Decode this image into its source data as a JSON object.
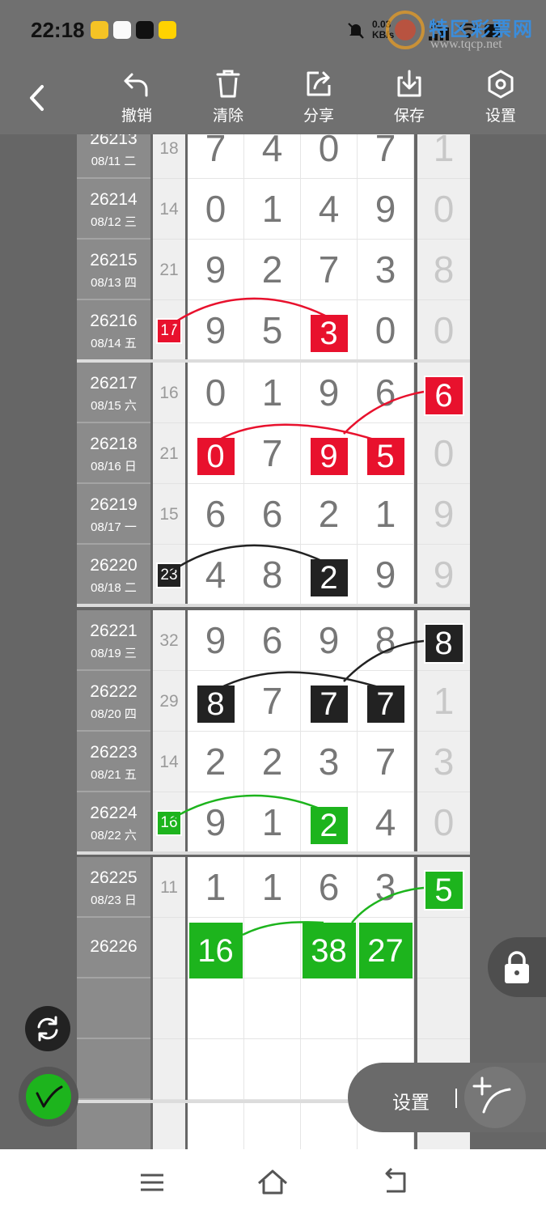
{
  "status_bar": {
    "time": "22:18",
    "net_speed_top": "0.03",
    "net_speed_unit": "KB/s",
    "signal_label": "5G",
    "watermark_title": "特区彩票网",
    "watermark_url": "www.tqcp.net"
  },
  "toolbar": {
    "undo_label": "撤销",
    "clear_label": "清除",
    "share_label": "分享",
    "save_label": "保存",
    "settings_label": "设置"
  },
  "rows": [
    {
      "issue": "26213",
      "date": "08/11 二",
      "sum": "18",
      "digits": [
        "7",
        "4",
        "0",
        "7"
      ],
      "last": "1"
    },
    {
      "issue": "26214",
      "date": "08/12 三",
      "sum": "14",
      "digits": [
        "0",
        "1",
        "4",
        "9"
      ],
      "last": "0"
    },
    {
      "issue": "26215",
      "date": "08/13 四",
      "sum": "21",
      "digits": [
        "9",
        "2",
        "7",
        "3"
      ],
      "last": "8"
    },
    {
      "issue": "26216",
      "date": "08/14 五",
      "sum": "17",
      "digits": [
        "9",
        "5",
        "3",
        "0"
      ],
      "last": "0"
    },
    {
      "issue": "26217",
      "date": "08/15 六",
      "sum": "16",
      "digits": [
        "0",
        "1",
        "9",
        "6"
      ],
      "last": "6"
    },
    {
      "issue": "26218",
      "date": "08/16 日",
      "sum": "21",
      "digits": [
        "0",
        "7",
        "9",
        "5"
      ],
      "last": "0"
    },
    {
      "issue": "26219",
      "date": "08/17 一",
      "sum": "15",
      "digits": [
        "6",
        "6",
        "2",
        "1"
      ],
      "last": "9"
    },
    {
      "issue": "26220",
      "date": "08/18 二",
      "sum": "23",
      "digits": [
        "4",
        "8",
        "2",
        "9"
      ],
      "last": "9"
    },
    {
      "issue": "26221",
      "date": "08/19 三",
      "sum": "32",
      "digits": [
        "9",
        "6",
        "9",
        "8"
      ],
      "last": "8"
    },
    {
      "issue": "26222",
      "date": "08/20 四",
      "sum": "29",
      "digits": [
        "8",
        "7",
        "7",
        "7"
      ],
      "last": "1"
    },
    {
      "issue": "26223",
      "date": "08/21 五",
      "sum": "14",
      "digits": [
        "2",
        "2",
        "3",
        "7"
      ],
      "last": "3"
    },
    {
      "issue": "26224",
      "date": "08/22 六",
      "sum": "16",
      "digits": [
        "9",
        "1",
        "2",
        "4"
      ],
      "last": "0"
    },
    {
      "issue": "26225",
      "date": "08/23 日",
      "sum": "11",
      "digits": [
        "1",
        "1",
        "6",
        "3"
      ],
      "last": "5"
    }
  ],
  "prediction": {
    "issue": "26226",
    "values": [
      "16",
      "38",
      "27"
    ]
  },
  "floating": {
    "settings_label": "设置"
  },
  "colors": {
    "red": "#e8112d",
    "black": "#222222",
    "green": "#1db41d"
  }
}
